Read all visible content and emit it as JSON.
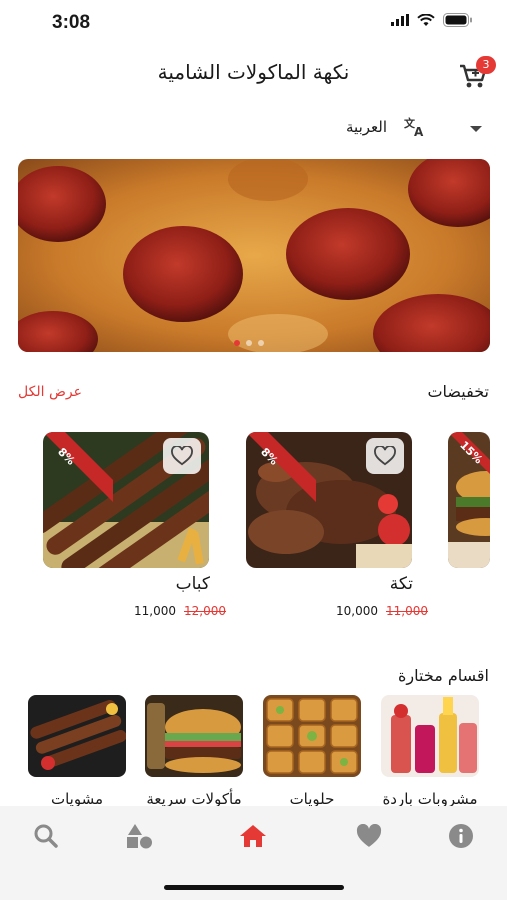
{
  "status_bar": {
    "time": "3:08"
  },
  "header": {
    "title": "نكهة الماكولات الشامية",
    "cart_count": "3"
  },
  "language": {
    "label": "العربية"
  },
  "discounts": {
    "title": "تخفيضات",
    "view_all": "عرض الكل",
    "items": [
      {
        "name": "كباب",
        "price": "11,000",
        "old_price": "12,000",
        "badge": "8%"
      },
      {
        "name": "تكة",
        "price": "10,000",
        "old_price": "11,000",
        "badge": "8%"
      },
      {
        "badge": "15%"
      }
    ]
  },
  "categories": {
    "title": "اقسام مختارة",
    "items": [
      {
        "label": "مشروبات باردة"
      },
      {
        "label": "حلويات"
      },
      {
        "label": "مأكولات سريعة"
      },
      {
        "label": "مشويات"
      }
    ]
  },
  "tabbar": {
    "items": [
      {
        "icon": "info-icon"
      },
      {
        "icon": "heart-icon"
      },
      {
        "icon": "home-icon",
        "active": true
      },
      {
        "icon": "shapes-icon"
      },
      {
        "icon": "search-icon"
      }
    ]
  },
  "colors": {
    "accent": "#e53935",
    "icon_gray": "#8a8a8a"
  }
}
